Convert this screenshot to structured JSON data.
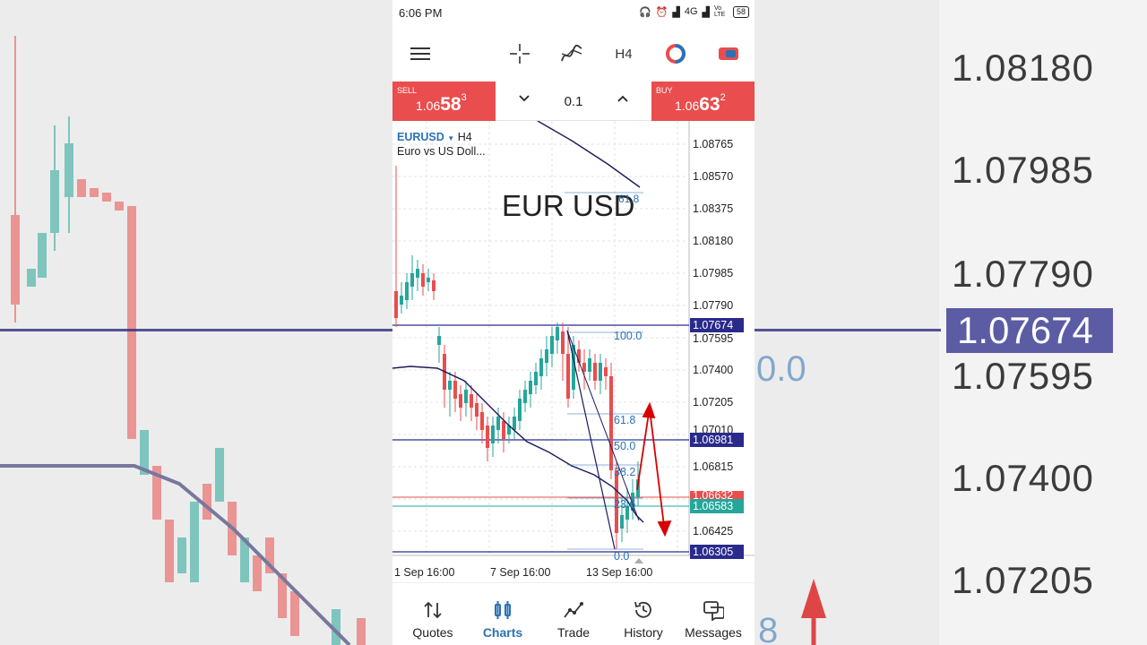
{
  "status_bar": {
    "time": "6:06 PM",
    "network": "4G",
    "volte": "Vo LTE",
    "battery": "58"
  },
  "toolbar": {
    "timeframe": "H4"
  },
  "trade": {
    "sell_label": "SELL",
    "sell_prefix": "1.06",
    "sell_big": "58",
    "sell_sup": "3",
    "buy_label": "BUY",
    "buy_prefix": "1.06",
    "buy_big": "63",
    "buy_sup": "2",
    "lot": "0.1"
  },
  "chart": {
    "symbol": "EURUSD",
    "timeframe": "H4",
    "description": "Euro vs US Doll...",
    "overlay_title": "EUR USD",
    "price_axis": [
      "1.08765",
      "1.08570",
      "1.08375",
      "1.08180",
      "1.07985",
      "1.07790",
      "1.07595",
      "1.07400",
      "1.07205",
      "1.07010",
      "1.06815",
      "1.06425"
    ],
    "tags": {
      "upper": "1.07674",
      "middle": "1.06981",
      "ask": "1.06632",
      "bid": "1.06583",
      "lower": "1.06305"
    },
    "time_axis": [
      "1 Sep 16:00",
      "7 Sep 16:00",
      "13 Sep 16:00"
    ],
    "fib_levels": [
      "100.0",
      "61.8",
      "50.0",
      "38.2",
      "23.6",
      "0.0"
    ],
    "top_fib_label": "61.8",
    "colors": {
      "bull": "#26a69a",
      "bear": "#e94d4d",
      "ma": "#1a1a5e",
      "level": "#2a2a8c",
      "fib": "#2a72b6"
    }
  },
  "background": {
    "labels": [
      "1.08180",
      "1.07985",
      "1.07790",
      "1.07595",
      "1.07400",
      "1.07205"
    ],
    "tag": "1.07674",
    "fib_fragment": "0.0",
    "fib_fragment2": "8"
  },
  "nav": [
    {
      "label": "Quotes",
      "icon": "quotes-icon"
    },
    {
      "label": "Charts",
      "icon": "charts-icon"
    },
    {
      "label": "Trade",
      "icon": "trade-icon"
    },
    {
      "label": "History",
      "icon": "history-icon"
    },
    {
      "label": "Messages",
      "icon": "messages-icon"
    }
  ]
}
